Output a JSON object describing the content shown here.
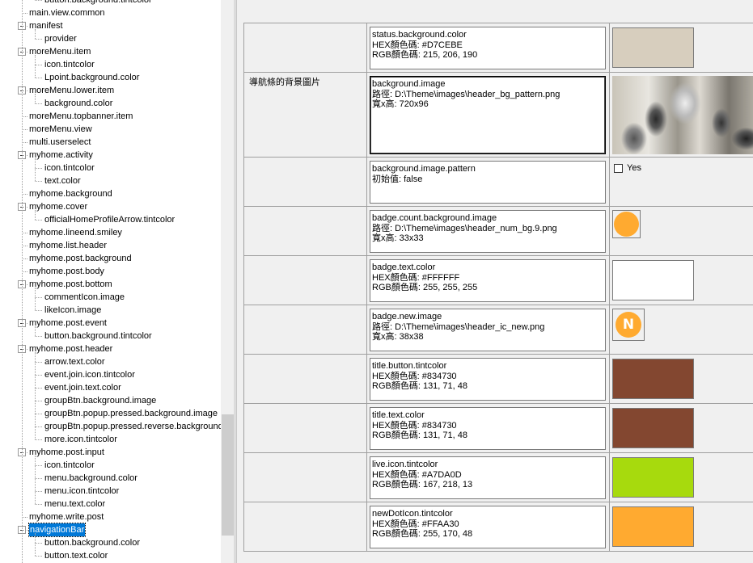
{
  "tree": {
    "items": [
      {
        "label": "button.background.tintcolor",
        "level": 1
      },
      {
        "label": "main.view.common",
        "level": 0
      },
      {
        "label": "manifest",
        "level": 0,
        "expanded": true
      },
      {
        "label": "provider",
        "level": 1
      },
      {
        "label": "moreMenu.item",
        "level": 0,
        "expanded": true
      },
      {
        "label": "icon.tintcolor",
        "level": 1
      },
      {
        "label": "Lpoint.background.color",
        "level": 1
      },
      {
        "label": "moreMenu.lower.item",
        "level": 0,
        "expanded": true
      },
      {
        "label": "background.color",
        "level": 1
      },
      {
        "label": "moreMenu.topbanner.item",
        "level": 0
      },
      {
        "label": "moreMenu.view",
        "level": 0
      },
      {
        "label": "multi.userselect",
        "level": 0
      },
      {
        "label": "myhome.activity",
        "level": 0,
        "expanded": true
      },
      {
        "label": "icon.tintcolor",
        "level": 1
      },
      {
        "label": "text.color",
        "level": 1
      },
      {
        "label": "myhome.background",
        "level": 0
      },
      {
        "label": "myhome.cover",
        "level": 0,
        "expanded": true
      },
      {
        "label": "officialHomeProfileArrow.tintcolor",
        "level": 1
      },
      {
        "label": "myhome.lineend.smiley",
        "level": 0
      },
      {
        "label": "myhome.list.header",
        "level": 0
      },
      {
        "label": "myhome.post.background",
        "level": 0
      },
      {
        "label": "myhome.post.body",
        "level": 0
      },
      {
        "label": "myhome.post.bottom",
        "level": 0,
        "expanded": true
      },
      {
        "label": "commentIcon.image",
        "level": 1
      },
      {
        "label": "likeIcon.image",
        "level": 1
      },
      {
        "label": "myhome.post.event",
        "level": 0,
        "expanded": true
      },
      {
        "label": "button.background.tintcolor",
        "level": 1
      },
      {
        "label": "myhome.post.header",
        "level": 0,
        "expanded": true
      },
      {
        "label": "arrow.text.color",
        "level": 1
      },
      {
        "label": "event.join.icon.tintcolor",
        "level": 1
      },
      {
        "label": "event.join.text.color",
        "level": 1
      },
      {
        "label": "groupBtn.background.image",
        "level": 1
      },
      {
        "label": "groupBtn.popup.pressed.background.image",
        "level": 1
      },
      {
        "label": "groupBtn.popup.pressed.reverse.background.",
        "level": 1
      },
      {
        "label": "more.icon.tintcolor",
        "level": 1
      },
      {
        "label": "myhome.post.input",
        "level": 0,
        "expanded": true
      },
      {
        "label": "icon.tintcolor",
        "level": 1
      },
      {
        "label": "menu.background.color",
        "level": 1
      },
      {
        "label": "menu.icon.tintcolor",
        "level": 1
      },
      {
        "label": "menu.text.color",
        "level": 1
      },
      {
        "label": "myhome.write.post",
        "level": 0
      },
      {
        "label": "navigationBar",
        "level": 0,
        "expanded": true,
        "selected": true
      },
      {
        "label": "button.background.color",
        "level": 1
      },
      {
        "label": "button.text.color",
        "level": 1
      }
    ]
  },
  "grid": {
    "rows": [
      {
        "label": "",
        "lines": [
          "status.background.color",
          "HEX顏色碼: #D7CEBE",
          "RGB顏色碼: 215, 206, 190"
        ],
        "preview": {
          "type": "color",
          "color": "#D7CEBE"
        }
      },
      {
        "label": "導航條的背景圖片",
        "lines": [
          "background.image",
          "路徑: D:\\Theme\\images\\header_bg_pattern.png",
          "寬x高: 720x96"
        ],
        "preview": {
          "type": "photo"
        },
        "active": true
      },
      {
        "label": "",
        "lines": [
          "background.image.pattern",
          "初始值: false"
        ],
        "preview": {
          "type": "checkbox",
          "text": "Yes",
          "checked": false
        }
      },
      {
        "label": "",
        "lines": [
          "badge.count.background.image",
          "路徑: D:\\Theme\\images\\header_num_bg.9.png",
          "寬x高: 33x33"
        ],
        "preview": {
          "type": "badge-circle",
          "color": "#FFAA30"
        }
      },
      {
        "label": "",
        "lines": [
          "badge.text.color",
          "HEX顏色碼: #FFFFFF",
          "RGB顏色碼: 255, 255, 255"
        ],
        "preview": {
          "type": "color",
          "color": "#FFFFFF"
        }
      },
      {
        "label": "",
        "lines": [
          "badge.new.image",
          "路徑: D:\\Theme\\images\\header_ic_new.png",
          "寬x高: 38x38"
        ],
        "preview": {
          "type": "badge-new",
          "color": "#FFAA30",
          "text": "N"
        }
      },
      {
        "label": "",
        "lines": [
          "title.button.tintcolor",
          "HEX顏色碼: #834730",
          "RGB顏色碼: 131, 71, 48"
        ],
        "preview": {
          "type": "color",
          "color": "#834730"
        }
      },
      {
        "label": "",
        "lines": [
          "title.text.color",
          "HEX顏色碼: #834730",
          "RGB顏色碼: 131, 71, 48"
        ],
        "preview": {
          "type": "color",
          "color": "#834730"
        }
      },
      {
        "label": "",
        "lines": [
          "live.icon.tintcolor",
          "HEX顏色碼: #A7DA0D",
          "RGB顏色碼: 167, 218, 13"
        ],
        "preview": {
          "type": "color",
          "color": "#A7DA0D"
        }
      },
      {
        "label": "",
        "lines": [
          "newDotIcon.tintcolor",
          "HEX顏色碼: #FFAA30",
          "RGB顏色碼: 255, 170, 48"
        ],
        "preview": {
          "type": "color",
          "color": "#FFAA30"
        }
      }
    ]
  }
}
